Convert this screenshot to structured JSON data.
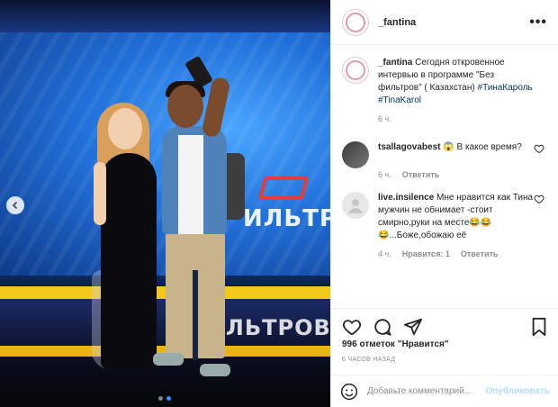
{
  "post": {
    "username": "_fantina",
    "more_label": "•••",
    "photo_sign": "ИЛЬТРОВ",
    "photo_floor_sign": "ФИЛЬТРОВ"
  },
  "caption": {
    "author": "_fantina",
    "text": "Сегодня откровенное интервью в программе \"Без фильтров\" ( Казахстан)",
    "tags": "#ТинаКароль #TinaKarol",
    "time": "6 ч."
  },
  "comments": [
    {
      "author": "tsallagovabest",
      "text": "😱 В какое время?",
      "time": "6 ч.",
      "reply": "Ответить"
    },
    {
      "author": "live.insilence",
      "text": "Мне нравится как Тина мужчин не обнимает -стоит смирно,руки на месте😂😂😂...Боже,обожаю её",
      "time": "4 ч.",
      "likes": "Нравится: 1",
      "reply": "Ответить"
    }
  ],
  "stats": {
    "likes": "996 отметок \"Нравится\"",
    "posted": "6 ЧАСОВ НАЗАД"
  },
  "add_comment": {
    "placeholder": "Добавьте комментарий...",
    "publish": "Опубликовать"
  },
  "colors": {
    "link": "#00376b",
    "muted": "#8e8e8e",
    "publish_disabled": "#b3dbff"
  }
}
